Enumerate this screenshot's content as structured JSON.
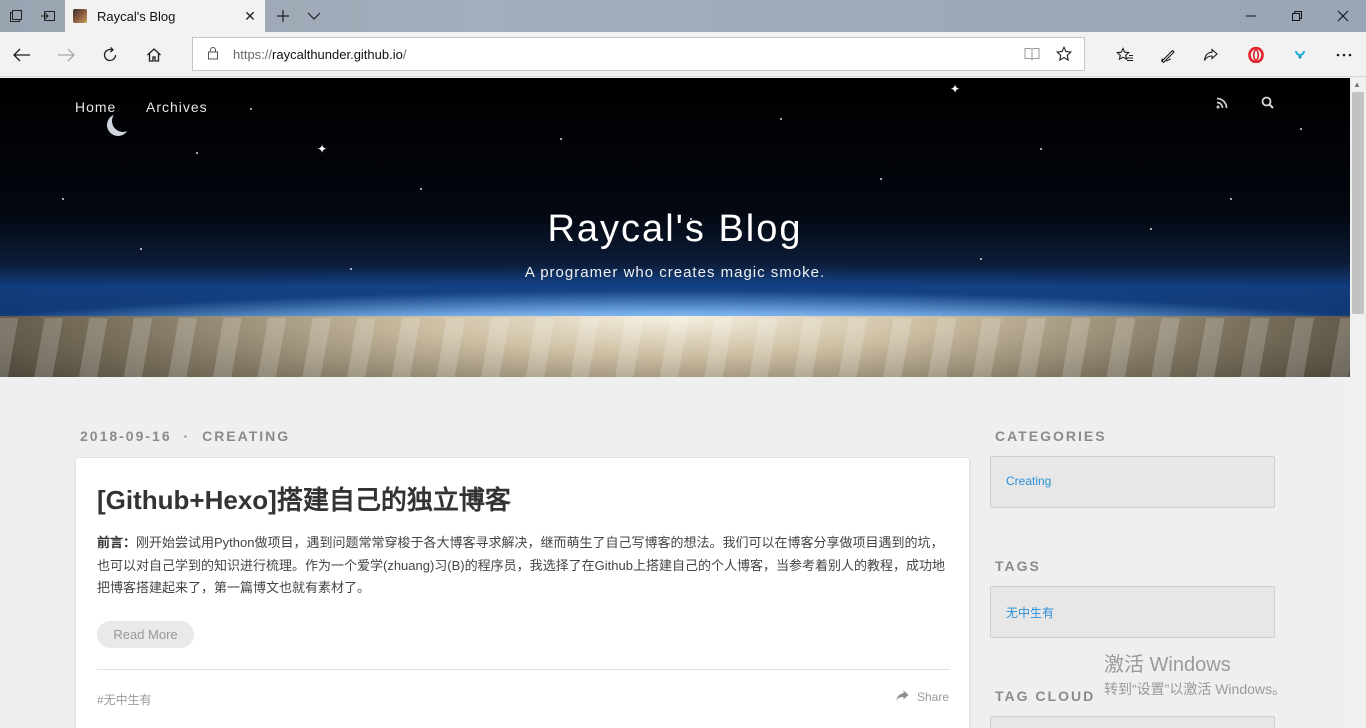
{
  "browser": {
    "tab": {
      "title": "Raycal's Blog"
    },
    "address": {
      "scheme": "https://",
      "host": "raycalthunder.github.io",
      "path": "/"
    },
    "icons": [
      "tab-actions-icon",
      "set-aside-tabs-icon",
      "close-icon",
      "new-tab-icon",
      "chevron-down-icon",
      "minimize-icon",
      "restore-icon",
      "window-close-icon",
      "back-icon",
      "forward-icon",
      "refresh-icon",
      "home-icon",
      "lock-icon",
      "reading-view-icon",
      "star-icon",
      "favorites-icon",
      "pen-icon",
      "share-icon",
      "opera-icon",
      "extension-icon",
      "more-icon"
    ]
  },
  "site": {
    "nav": {
      "home": "Home",
      "archives": "Archives"
    },
    "title": "Raycal's Blog",
    "subtitle": "A programer who creates magic smoke."
  },
  "post": {
    "date": "2018-09-16",
    "separator": "·",
    "category": "CREATING",
    "title": "[Github+Hexo]搭建自己的独立博客",
    "lead": "前言：",
    "body": "刚开始尝试用Python做项目，遇到问题常常穿梭于各大博客寻求解决，继而萌生了自己写博客的想法。我们可以在博客分享做项目遇到的坑，也可以对自己学到的知识进行梳理。作为一个爱学(zhuang)习(B)的程序员，我选择了在Github上搭建自己的个人博客，当参考着别人的教程，成功地把博客搭建起来了，第一篇博文也就有素材了。",
    "read_more": "Read More",
    "tag": "#无中生有",
    "share": "Share"
  },
  "sidebar": {
    "categories_heading": "CATEGORIES",
    "category_link": "Creating",
    "tags_heading": "TAGS",
    "tag_link": "无中生有",
    "tag_cloud_heading": "TAG CLOUD"
  },
  "watermark": {
    "line1": "激活 Windows",
    "line2": "转到“设置”以激活 Windows。"
  }
}
